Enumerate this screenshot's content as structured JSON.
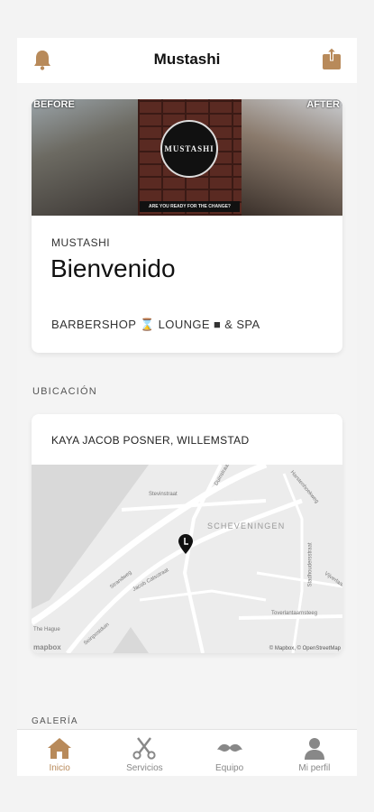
{
  "header": {
    "title": "Mustashi"
  },
  "hero": {
    "banner": {
      "before_label": "BEFORE",
      "after_label": "AFTER",
      "logo_text": "MUSTASHI",
      "slogan": "ARE YOU READY FOR THE CHANGE?"
    },
    "brand": "MUSTASHI",
    "welcome": "Bienvenido",
    "tagline": "BARBERSHOP ⌛ LOUNGE ■ & SPA"
  },
  "location": {
    "section_label": "UBICACIÓN",
    "address": "KAYA JACOB POSNER, WILLEMSTAD",
    "map": {
      "district": "SCHEVENINGEN",
      "attribution": "© Mapbox, © OpenStreetMap",
      "logo": "mapbox",
      "streets": [
        "Stevinstraat",
        "Strandweg",
        "Jacob Catsstraat",
        "Seinpostduin",
        "Duinstraat",
        "Harstenhoekweg",
        "Stadhoudersstraat",
        "Vijverlaan",
        "Toverlantaarnsteeg",
        "The Hague"
      ]
    }
  },
  "gallery": {
    "section_label": "GALERÍA"
  },
  "tabs": [
    {
      "label": "Inicio",
      "icon": "home-icon",
      "active": true
    },
    {
      "label": "Servicios",
      "icon": "scissors-icon",
      "active": false
    },
    {
      "label": "Equipo",
      "icon": "mustache-icon",
      "active": false
    },
    {
      "label": "Mi perfil",
      "icon": "user-icon",
      "active": false
    }
  ],
  "colors": {
    "accent": "#b88a5a",
    "inactive": "#888888"
  }
}
